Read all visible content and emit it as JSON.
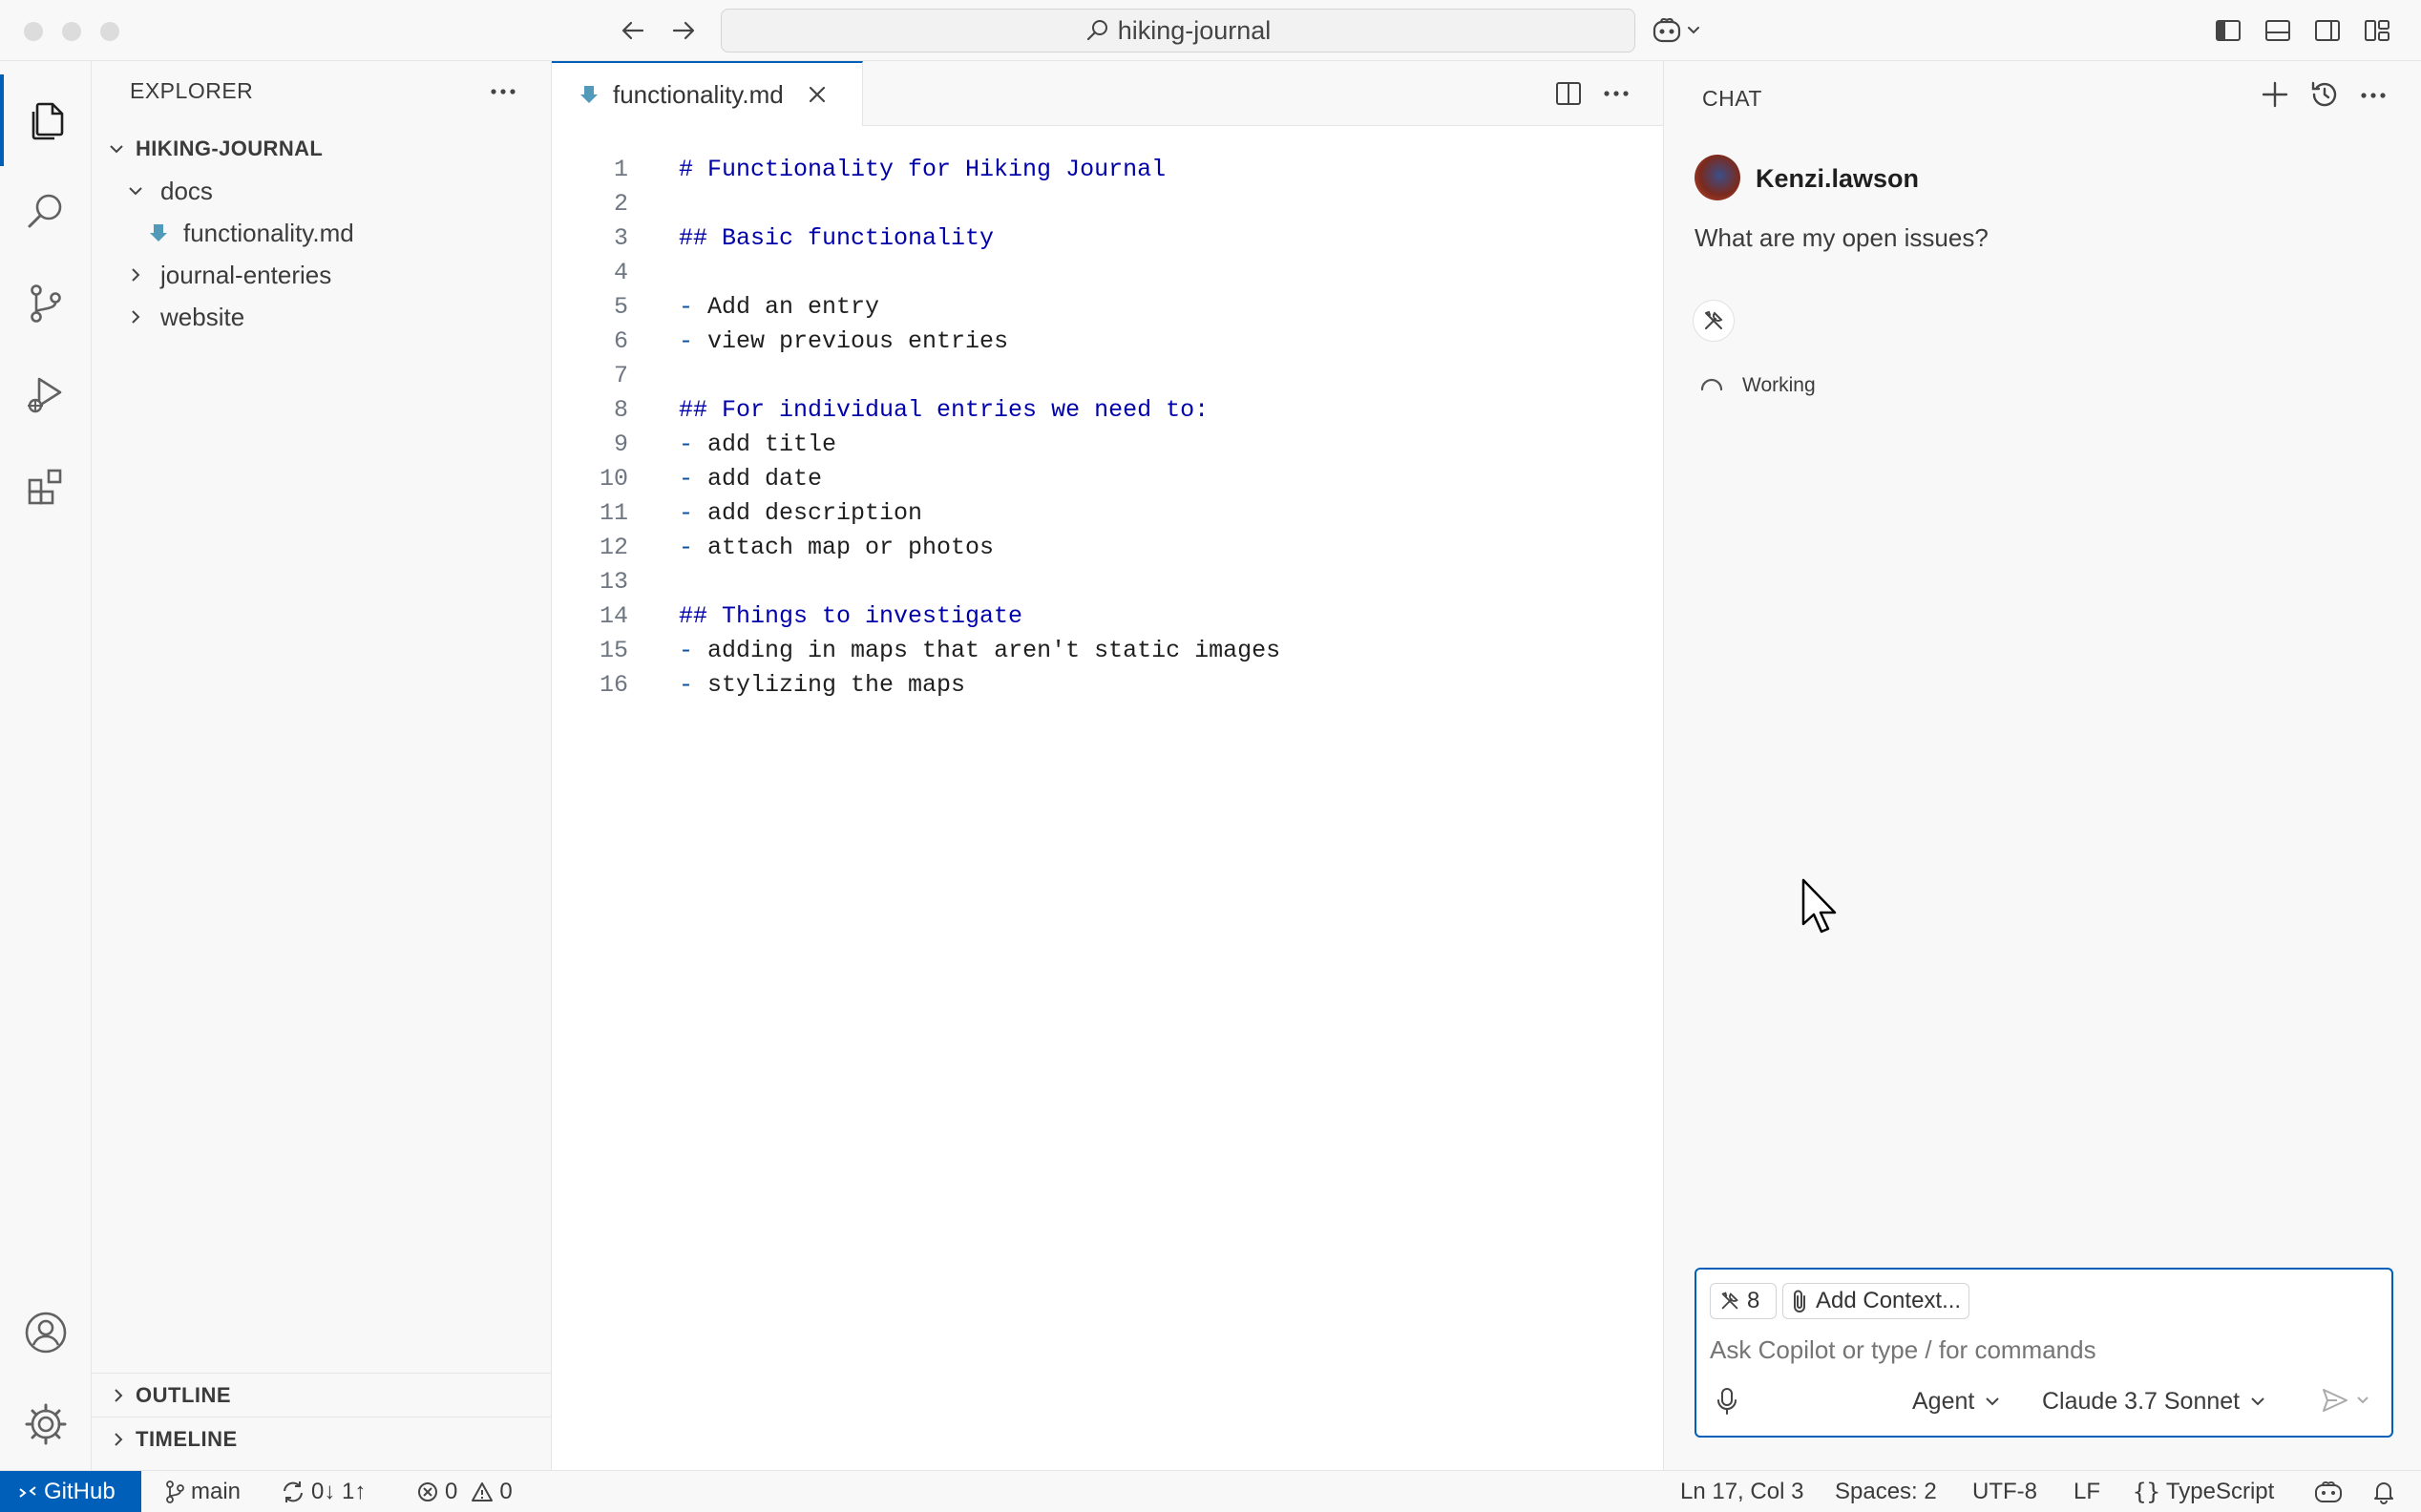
{
  "titlebar": {
    "search_text": "hiking-journal"
  },
  "sidebar": {
    "title": "EXPLORER",
    "root": "HIKING-JOURNAL",
    "tree": [
      {
        "label": "docs",
        "type": "folder",
        "expanded": true
      },
      {
        "label": "functionality.md",
        "type": "file"
      },
      {
        "label": "journal-enteries",
        "type": "folder",
        "expanded": false
      },
      {
        "label": "website",
        "type": "folder",
        "expanded": false
      }
    ],
    "outline_label": "OUTLINE",
    "timeline_label": "TIMELINE"
  },
  "editor": {
    "tab_label": "functionality.md",
    "lines": [
      {
        "n": "1",
        "text": "# Functionality for Hiking Journal",
        "kind": "heading"
      },
      {
        "n": "2",
        "text": "",
        "kind": "blank"
      },
      {
        "n": "3",
        "text": "## Basic functionality",
        "kind": "heading"
      },
      {
        "n": "4",
        "text": "",
        "kind": "blank"
      },
      {
        "n": "5",
        "text": "Add an entry",
        "kind": "bullet"
      },
      {
        "n": "6",
        "text": "view previous entries",
        "kind": "bullet"
      },
      {
        "n": "7",
        "text": "",
        "kind": "blank"
      },
      {
        "n": "8",
        "text": "## For individual entries we need to:",
        "kind": "heading"
      },
      {
        "n": "9",
        "text": "add title",
        "kind": "bullet"
      },
      {
        "n": "10",
        "text": "add date",
        "kind": "bullet"
      },
      {
        "n": "11",
        "text": "add description",
        "kind": "bullet"
      },
      {
        "n": "12",
        "text": "attach map or photos",
        "kind": "bullet"
      },
      {
        "n": "13",
        "text": "",
        "kind": "blank"
      },
      {
        "n": "14",
        "text": "## Things to investigate",
        "kind": "heading"
      },
      {
        "n": "15",
        "text": "adding in maps that aren't static images",
        "kind": "bullet"
      },
      {
        "n": "16",
        "text": "stylizing the maps",
        "kind": "bullet"
      }
    ]
  },
  "chat": {
    "title": "CHAT",
    "user_name": "Kenzi.lawson",
    "message": "What are my open issues?",
    "status": "Working",
    "tools_count": "8",
    "add_context": "Add Context...",
    "placeholder": "Ask Copilot or type / for commands",
    "mode": "Agent",
    "model": "Claude 3.7 Sonnet"
  },
  "statusbar": {
    "remote": "GitHub",
    "branch": "main",
    "sync": "0↓ 1↑",
    "errors": "0",
    "warnings": "0",
    "position": "Ln 17, Col 3",
    "spaces": "Spaces: 2",
    "encoding": "UTF-8",
    "eol": "LF",
    "language": "TypeScript"
  },
  "colors": {
    "accent": "#005fb8",
    "heading": "#0000aa",
    "bullet": "#0451a5",
    "markdown_icon": "#519aba"
  }
}
